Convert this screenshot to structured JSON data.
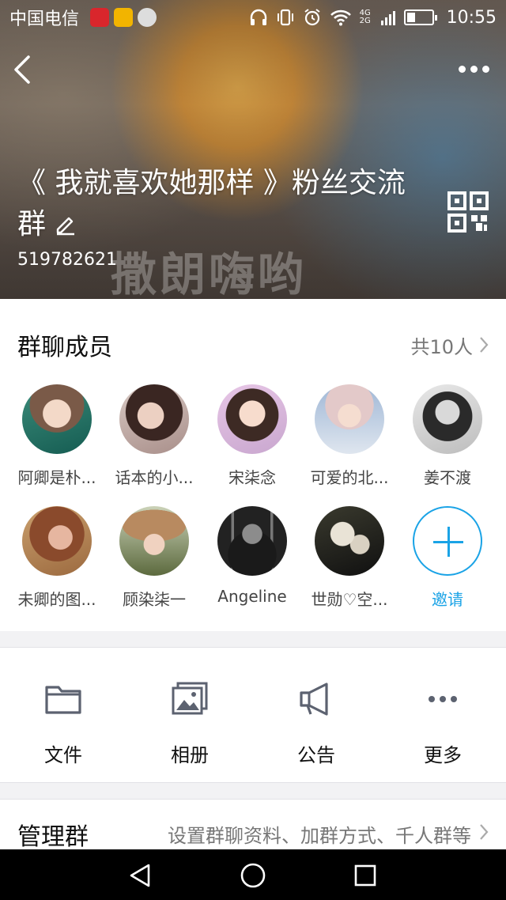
{
  "status_bar": {
    "carrier": "中国电信",
    "network": "4G 2G",
    "time": "10:55"
  },
  "group": {
    "title": "《 我就喜欢她那样 》粉丝交流群",
    "id": "519782621",
    "watermark": "撒朗嗨哟"
  },
  "members": {
    "title": "群聊成员",
    "count_label": "共10人",
    "list": [
      {
        "name": "阿卿是朴..."
      },
      {
        "name": "话本的小..."
      },
      {
        "name": "宋柒念"
      },
      {
        "name": "可爱的北..."
      },
      {
        "name": "姜不渡"
      },
      {
        "name": "未卿的图..."
      },
      {
        "name": "顾染柒一"
      },
      {
        "name": "Angeline"
      },
      {
        "name": "世勋♡空..."
      }
    ],
    "invite_label": "邀请"
  },
  "actions": [
    {
      "label": "文件",
      "icon": "folder-icon"
    },
    {
      "label": "相册",
      "icon": "album-icon"
    },
    {
      "label": "公告",
      "icon": "megaphone-icon"
    },
    {
      "label": "更多",
      "icon": "more-horizontal-icon"
    }
  ],
  "manage": {
    "title": "管理群",
    "description": "设置群聊资料、加群方式、千人群等"
  },
  "colors": {
    "accent": "#1aa3e6",
    "icon_gray": "#5c6270",
    "background": "#f2f2f4"
  }
}
